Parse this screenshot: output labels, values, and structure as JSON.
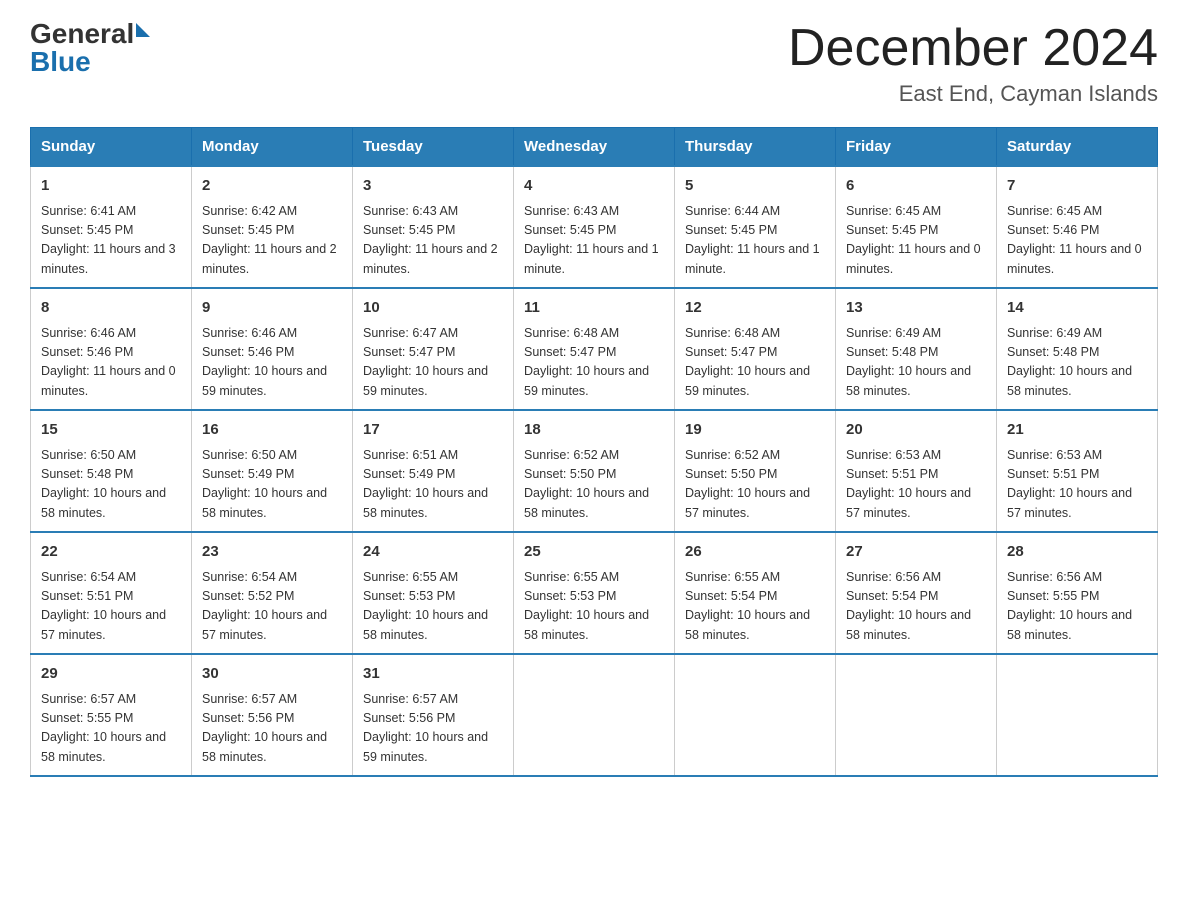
{
  "header": {
    "logo_general": "General",
    "logo_blue": "Blue",
    "month_title": "December 2024",
    "location": "East End, Cayman Islands"
  },
  "days_of_week": [
    "Sunday",
    "Monday",
    "Tuesday",
    "Wednesday",
    "Thursday",
    "Friday",
    "Saturday"
  ],
  "weeks": [
    [
      {
        "day": "1",
        "sunrise": "6:41 AM",
        "sunset": "5:45 PM",
        "daylight": "11 hours and 3 minutes."
      },
      {
        "day": "2",
        "sunrise": "6:42 AM",
        "sunset": "5:45 PM",
        "daylight": "11 hours and 2 minutes."
      },
      {
        "day": "3",
        "sunrise": "6:43 AM",
        "sunset": "5:45 PM",
        "daylight": "11 hours and 2 minutes."
      },
      {
        "day": "4",
        "sunrise": "6:43 AM",
        "sunset": "5:45 PM",
        "daylight": "11 hours and 1 minute."
      },
      {
        "day": "5",
        "sunrise": "6:44 AM",
        "sunset": "5:45 PM",
        "daylight": "11 hours and 1 minute."
      },
      {
        "day": "6",
        "sunrise": "6:45 AM",
        "sunset": "5:45 PM",
        "daylight": "11 hours and 0 minutes."
      },
      {
        "day": "7",
        "sunrise": "6:45 AM",
        "sunset": "5:46 PM",
        "daylight": "11 hours and 0 minutes."
      }
    ],
    [
      {
        "day": "8",
        "sunrise": "6:46 AM",
        "sunset": "5:46 PM",
        "daylight": "11 hours and 0 minutes."
      },
      {
        "day": "9",
        "sunrise": "6:46 AM",
        "sunset": "5:46 PM",
        "daylight": "10 hours and 59 minutes."
      },
      {
        "day": "10",
        "sunrise": "6:47 AM",
        "sunset": "5:47 PM",
        "daylight": "10 hours and 59 minutes."
      },
      {
        "day": "11",
        "sunrise": "6:48 AM",
        "sunset": "5:47 PM",
        "daylight": "10 hours and 59 minutes."
      },
      {
        "day": "12",
        "sunrise": "6:48 AM",
        "sunset": "5:47 PM",
        "daylight": "10 hours and 59 minutes."
      },
      {
        "day": "13",
        "sunrise": "6:49 AM",
        "sunset": "5:48 PM",
        "daylight": "10 hours and 58 minutes."
      },
      {
        "day": "14",
        "sunrise": "6:49 AM",
        "sunset": "5:48 PM",
        "daylight": "10 hours and 58 minutes."
      }
    ],
    [
      {
        "day": "15",
        "sunrise": "6:50 AM",
        "sunset": "5:48 PM",
        "daylight": "10 hours and 58 minutes."
      },
      {
        "day": "16",
        "sunrise": "6:50 AM",
        "sunset": "5:49 PM",
        "daylight": "10 hours and 58 minutes."
      },
      {
        "day": "17",
        "sunrise": "6:51 AM",
        "sunset": "5:49 PM",
        "daylight": "10 hours and 58 minutes."
      },
      {
        "day": "18",
        "sunrise": "6:52 AM",
        "sunset": "5:50 PM",
        "daylight": "10 hours and 58 minutes."
      },
      {
        "day": "19",
        "sunrise": "6:52 AM",
        "sunset": "5:50 PM",
        "daylight": "10 hours and 57 minutes."
      },
      {
        "day": "20",
        "sunrise": "6:53 AM",
        "sunset": "5:51 PM",
        "daylight": "10 hours and 57 minutes."
      },
      {
        "day": "21",
        "sunrise": "6:53 AM",
        "sunset": "5:51 PM",
        "daylight": "10 hours and 57 minutes."
      }
    ],
    [
      {
        "day": "22",
        "sunrise": "6:54 AM",
        "sunset": "5:51 PM",
        "daylight": "10 hours and 57 minutes."
      },
      {
        "day": "23",
        "sunrise": "6:54 AM",
        "sunset": "5:52 PM",
        "daylight": "10 hours and 57 minutes."
      },
      {
        "day": "24",
        "sunrise": "6:55 AM",
        "sunset": "5:53 PM",
        "daylight": "10 hours and 58 minutes."
      },
      {
        "day": "25",
        "sunrise": "6:55 AM",
        "sunset": "5:53 PM",
        "daylight": "10 hours and 58 minutes."
      },
      {
        "day": "26",
        "sunrise": "6:55 AM",
        "sunset": "5:54 PM",
        "daylight": "10 hours and 58 minutes."
      },
      {
        "day": "27",
        "sunrise": "6:56 AM",
        "sunset": "5:54 PM",
        "daylight": "10 hours and 58 minutes."
      },
      {
        "day": "28",
        "sunrise": "6:56 AM",
        "sunset": "5:55 PM",
        "daylight": "10 hours and 58 minutes."
      }
    ],
    [
      {
        "day": "29",
        "sunrise": "6:57 AM",
        "sunset": "5:55 PM",
        "daylight": "10 hours and 58 minutes."
      },
      {
        "day": "30",
        "sunrise": "6:57 AM",
        "sunset": "5:56 PM",
        "daylight": "10 hours and 58 minutes."
      },
      {
        "day": "31",
        "sunrise": "6:57 AM",
        "sunset": "5:56 PM",
        "daylight": "10 hours and 59 minutes."
      },
      null,
      null,
      null,
      null
    ]
  ]
}
